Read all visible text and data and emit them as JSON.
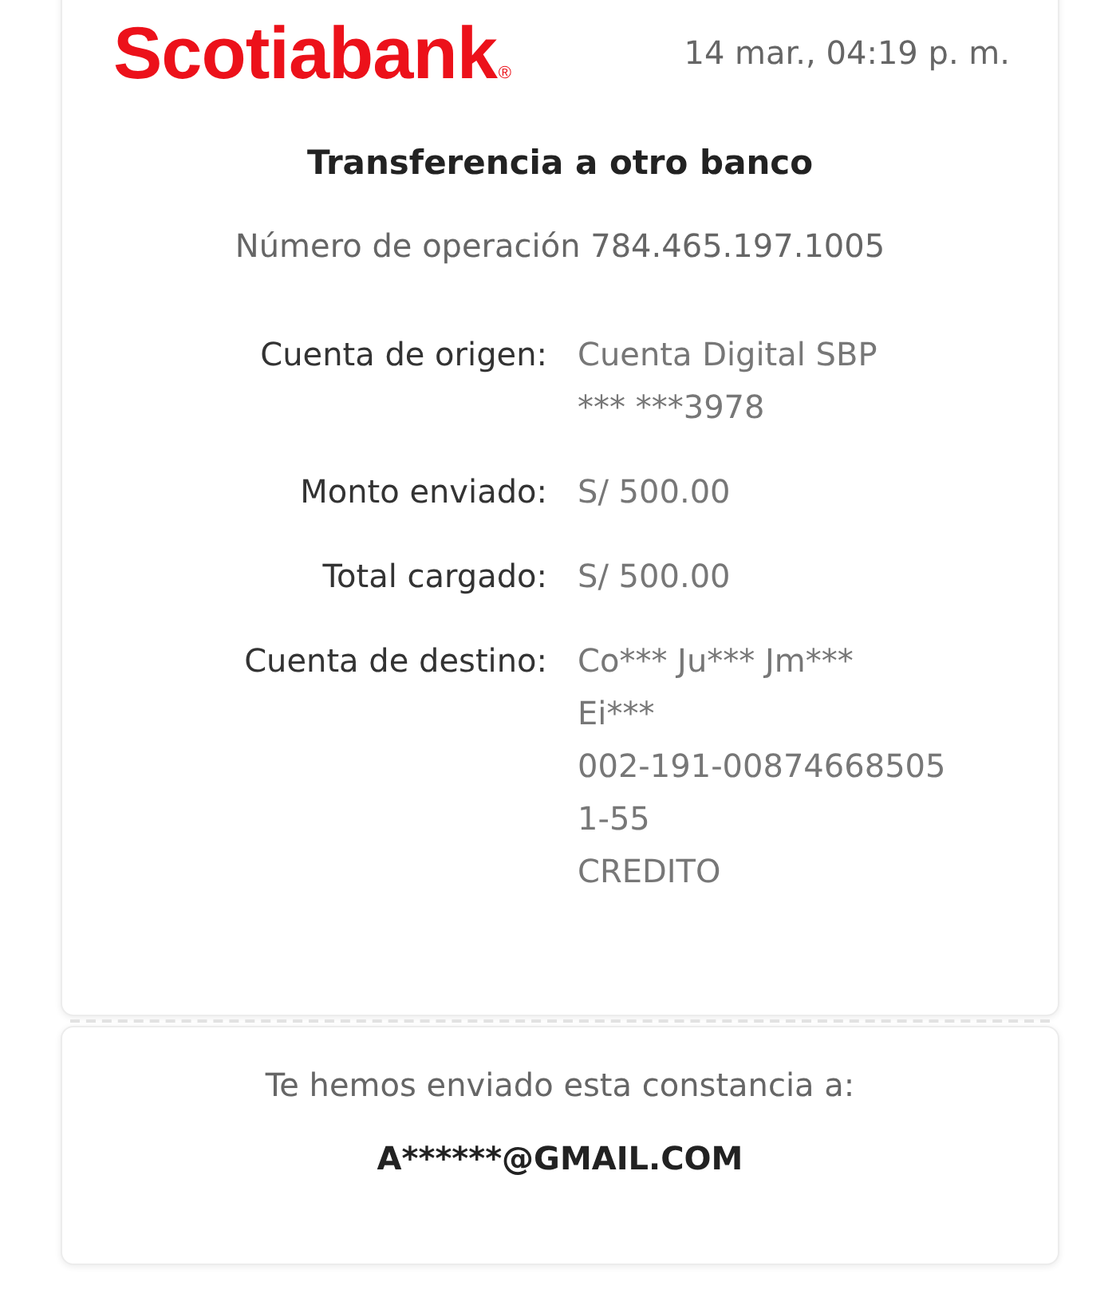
{
  "header": {
    "logo": "Scotiabank",
    "logo_mark": "®",
    "datetime": "14 mar., 04:19 p. m."
  },
  "title": "Transferencia a otro banco",
  "operation": "Número de operación 784.465.197.1005",
  "details": [
    {
      "label": "Cuenta de origen:",
      "lines": [
        "Cuenta Digital SBP",
        "*** ***3978"
      ]
    },
    {
      "label": "Monto enviado:",
      "lines": [
        "S/ 500.00"
      ]
    },
    {
      "label": "Total cargado:",
      "lines": [
        "S/ 500.00"
      ]
    },
    {
      "label": "Cuenta de destino:",
      "lines": [
        "Co*** Ju*** Jm***",
        "Ei***",
        "002-191-00874668505",
        "1-55",
        "CREDITO"
      ]
    }
  ],
  "footer": {
    "message": "Te hemos enviado esta constancia a:",
    "email": "A******@GMAIL.COM"
  }
}
